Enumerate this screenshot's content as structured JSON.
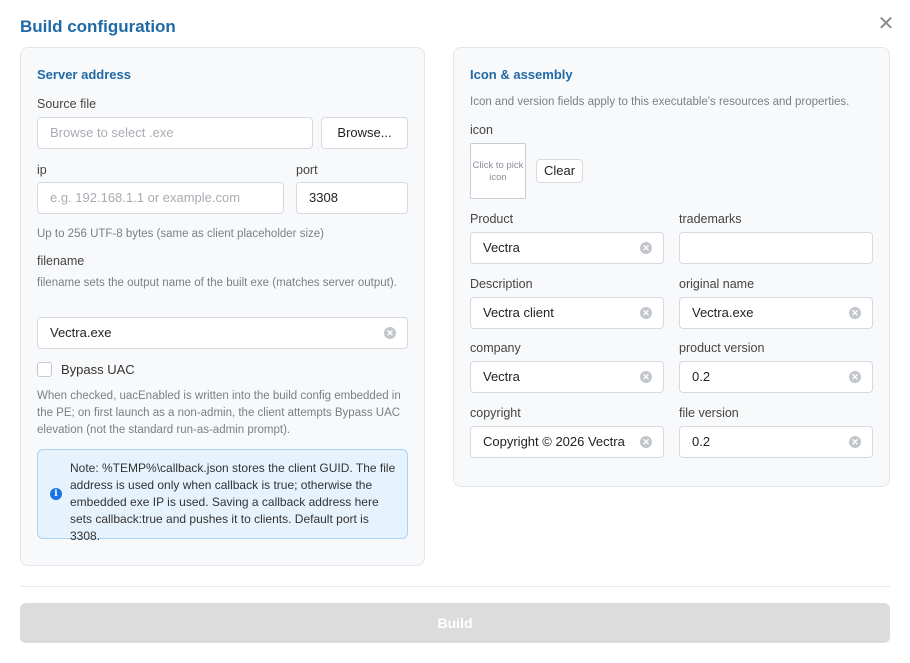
{
  "dialog": {
    "title": "Build configuration",
    "close_icon": "close-icon"
  },
  "server": {
    "section_title": "Server address",
    "source_file": {
      "label": "Source file",
      "placeholder": "Browse to select .exe",
      "browse_label": "Browse..."
    },
    "ip": {
      "label": "ip",
      "placeholder": "e.g. 192.168.1.1 or example.com"
    },
    "port": {
      "label": "port",
      "value": "3308"
    },
    "size_hint": "Up to 256 UTF-8 bytes (same as client placeholder size)",
    "filename": {
      "label": "filename",
      "hint": "filename sets the output name of the built exe (matches server output).",
      "value": "Vectra.exe"
    },
    "bypass_uac": {
      "label": "Bypass UAC",
      "checked": false,
      "hint": "When checked, uacEnabled is written into the build config embedded in the PE; on first launch as a non-admin, the client attempts Bypass UAC elevation (not the standard run-as-admin prompt)."
    },
    "note": "Note: %TEMP%\\callback.json stores the client GUID. The file address is used only when callback is true; otherwise the embedded exe IP is used. Saving a callback address here sets callback:true and pushes it to clients. Default port is 3308."
  },
  "assembly": {
    "section_title": "Icon & assembly",
    "hint": "Icon and version fields apply to this executable's resources and properties.",
    "icon": {
      "label": "icon",
      "placeholder": "Click to pick icon",
      "clear_label": "Clear"
    },
    "product": {
      "label": "Product",
      "value": "Vectra"
    },
    "trademarks": {
      "label": "trademarks",
      "value": ""
    },
    "description": {
      "label": "Description",
      "value": "Vectra client"
    },
    "original_name": {
      "label": "original name",
      "value": "Vectra.exe"
    },
    "company": {
      "label": "company",
      "value": "Vectra"
    },
    "product_version": {
      "label": "product version",
      "value": "0.2"
    },
    "copyright": {
      "label": "copyright",
      "value": "Copyright © 2026 Vectra"
    },
    "file_version": {
      "label": "file version",
      "value": "0.2"
    }
  },
  "build_label": "Build",
  "colors": {
    "accent": "#1f6aa5",
    "note_bg": "#e6f3fd",
    "info_icon": "#1a73e8",
    "build_disabled": "#dcdcdc"
  }
}
